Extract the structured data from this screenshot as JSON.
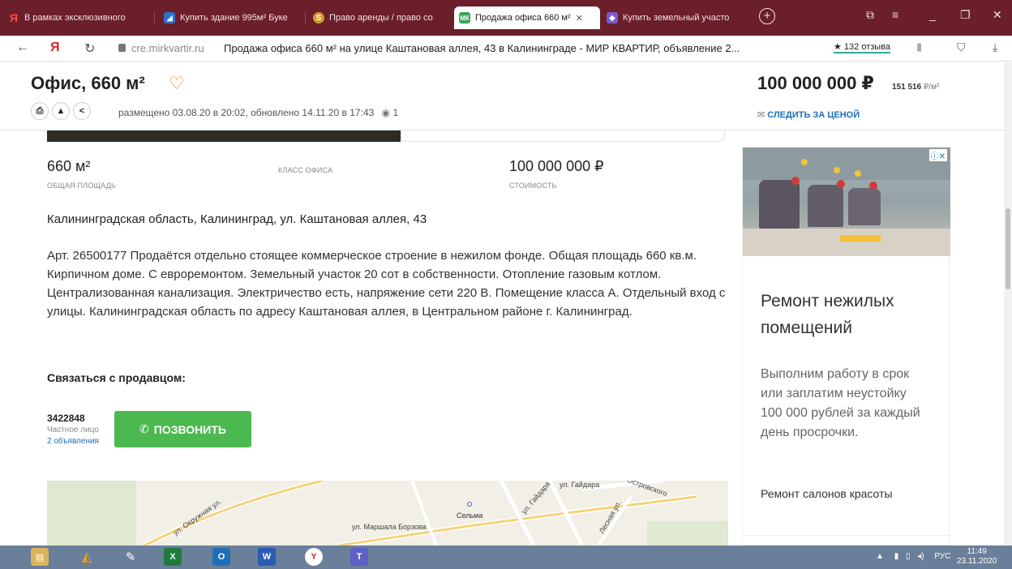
{
  "browser": {
    "tabs": [
      {
        "label": "В рамках эксклюзивного",
        "icon": "yandex-icon",
        "color": "#d12b2b"
      },
      {
        "label": "Купить здание 995м² Буке",
        "icon": "avito-icon",
        "color": "#2b6fd1"
      },
      {
        "label": "Право аренды / право со",
        "icon": "sp-icon",
        "color": "#d19a2b"
      },
      {
        "label": "Продажа офиса 660 м²",
        "icon": "mk-icon",
        "color": "#3aa655",
        "active": true
      },
      {
        "label": "Купить земельный участо",
        "icon": "cian-icon",
        "color": "#7a5ad1"
      }
    ],
    "new_tab": "+",
    "url_domain": "cre.mirkvartir.ru",
    "page_title": "Продажа офиса 660 м² на улице Каштановая аллея, 43 в Калининграде - МИР КВАРТИР, объявление 2...",
    "reviews": "★ 132 отзыва"
  },
  "header": {
    "title": "Офис, 660 м²",
    "price": "100 000 000 ₽",
    "price_per_m2_value": "151 516",
    "price_per_m2_unit": "₽/м²",
    "posted": "размещено 03.08.20 в 20:02, обновлено 14.11.20 в 17:43",
    "views": "1",
    "follow_price": "СЛЕДИТЬ ЗА ЦЕНОЙ"
  },
  "stats": [
    {
      "value": "660 м²",
      "label": "общая площадь"
    },
    {
      "value": "",
      "label": "класс офиса"
    },
    {
      "value": "100 000 000 ₽",
      "label": "стоимость"
    }
  ],
  "address": "Калининградская область, Калининград, ул. Каштановая аллея, 43",
  "description": "Арт. 26500177 Продаётся отдельно стоящее коммерческое строение в нежилом фонде. Общая площадь 660 кв.м. Кирпичном доме. С евроремонтом. Земельный участок 20 сот в собственности. Отопление газовым котлом. Централизованная канализация. Электричество есть, напряжение сети 220 В. Помещение класса А. Отдельный вход с улицы. Калининградская область по адресу Каштановая аллея, в Центральном районе г. Калининград.",
  "contact": {
    "heading": "Связаться с продавцом:",
    "phone": "3422848",
    "type": "Частное лицо",
    "ads": "2 объявления",
    "call_button": "ПОЗВОНИТЬ"
  },
  "map": {
    "labels": [
      "ул. Окружная ул.",
      "ул. Маршала Борзова",
      "Сельма",
      "ул. Гайдара",
      "ул. Гайдара",
      "ул. Островского",
      "Лесная ул."
    ]
  },
  "ad": {
    "badge": "ⓘ✕",
    "title": "Ремонт нежилых помещений",
    "text": "Выполним работу в срок или заплатим неустойку 100 000 рублей за каждый день просрочки.",
    "footer": "Ремонт салонов красоты"
  },
  "taskbar": {
    "lang": "РУС",
    "time": "11:49",
    "date": "23.11.2020"
  }
}
